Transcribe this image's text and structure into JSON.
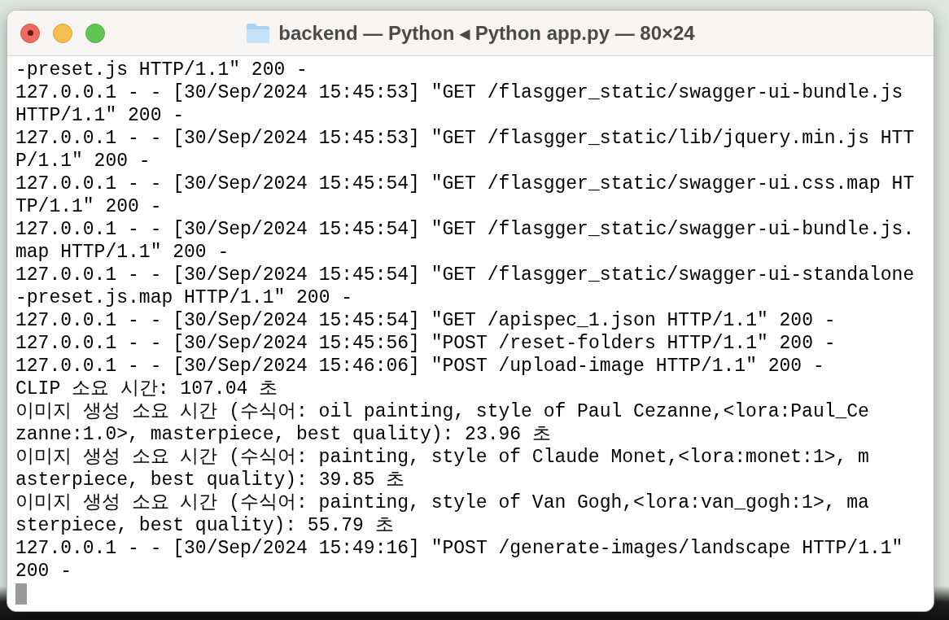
{
  "window": {
    "title": "backend — Python ◂ Python app.py — 80×24"
  },
  "terminal": {
    "lines": [
      "-preset.js HTTP/1.1\" 200 -",
      "127.0.0.1 - - [30/Sep/2024 15:45:53] \"GET /flasgger_static/swagger-ui-bundle.js",
      "HTTP/1.1\" 200 -",
      "127.0.0.1 - - [30/Sep/2024 15:45:53] \"GET /flasgger_static/lib/jquery.min.js HTT",
      "P/1.1\" 200 -",
      "127.0.0.1 - - [30/Sep/2024 15:45:54] \"GET /flasgger_static/swagger-ui.css.map HT",
      "TP/1.1\" 200 -",
      "127.0.0.1 - - [30/Sep/2024 15:45:54] \"GET /flasgger_static/swagger-ui-bundle.js.",
      "map HTTP/1.1\" 200 -",
      "127.0.0.1 - - [30/Sep/2024 15:45:54] \"GET /flasgger_static/swagger-ui-standalone",
      "-preset.js.map HTTP/1.1\" 200 -",
      "127.0.0.1 - - [30/Sep/2024 15:45:54] \"GET /apispec_1.json HTTP/1.1\" 200 -",
      "127.0.0.1 - - [30/Sep/2024 15:45:56] \"POST /reset-folders HTTP/1.1\" 200 -",
      "127.0.0.1 - - [30/Sep/2024 15:46:06] \"POST /upload-image HTTP/1.1\" 200 -",
      "CLIP 소요 시간: 107.04 초",
      "이미지 생성 소요 시간 (수식어: oil painting, style of Paul Cezanne,<lora:Paul_Ce",
      "zanne:1.0>, masterpiece, best quality): 23.96 초",
      "이미지 생성 소요 시간 (수식어: painting, style of Claude Monet,<lora:monet:1>, m",
      "asterpiece, best quality): 39.85 초",
      "이미지 생성 소요 시간 (수식어: painting, style of Van Gogh,<lora:van_gogh:1>, ma",
      "sterpiece, best quality): 55.79 초",
      "127.0.0.1 - - [30/Sep/2024 15:49:16] \"POST /generate-images/landscape HTTP/1.1\"",
      "200 -"
    ]
  }
}
